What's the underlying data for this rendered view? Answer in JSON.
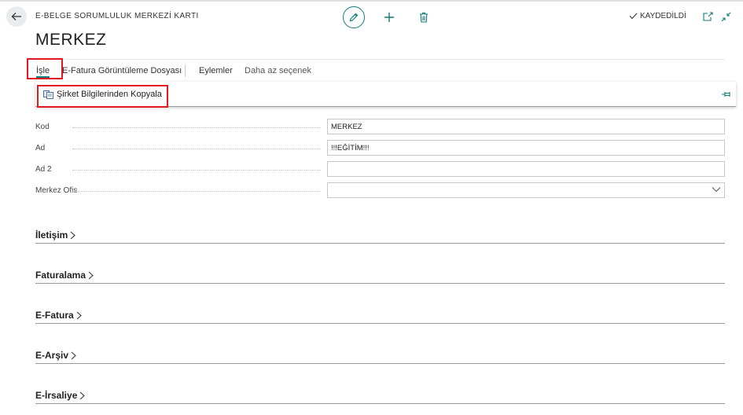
{
  "header": {
    "breadcrumb": "E-BELGE SORUMLULUK MERKEZİ KARTI",
    "saved_status": "KAYDEDİLDİ",
    "title": "MERKEZ"
  },
  "actions": {
    "process": "İşle",
    "efatura_file": "E-Fatura Görüntüleme Dosyası",
    "actions_menu": "Eylemler",
    "fewer_options": "Daha az seçenek"
  },
  "dropdown": {
    "copy_item": "Şirket Bilgilerinden Kopyala"
  },
  "fields": [
    {
      "label": "Kod",
      "value": "MERKEZ"
    },
    {
      "label": "Ad",
      "value": "!!!EĞİTİM!!!"
    },
    {
      "label": "Ad 2",
      "value": ""
    },
    {
      "label": "Merkez Ofis",
      "value": ""
    }
  ],
  "sections": [
    "İletişim",
    "Faturalama",
    "E-Fatura",
    "E-Arşiv",
    "E-İrsaliye"
  ],
  "colors": {
    "accent": "#0f7b7b",
    "highlight": "#e3191f"
  },
  "icons": [
    "back-arrow-icon",
    "pencil-icon",
    "plus-icon",
    "trash-icon",
    "checkmark-icon",
    "open-new-window-icon",
    "collapse-icon",
    "copy-icon",
    "pin-icon",
    "chevron-down-icon",
    "chevron-right-icon"
  ]
}
